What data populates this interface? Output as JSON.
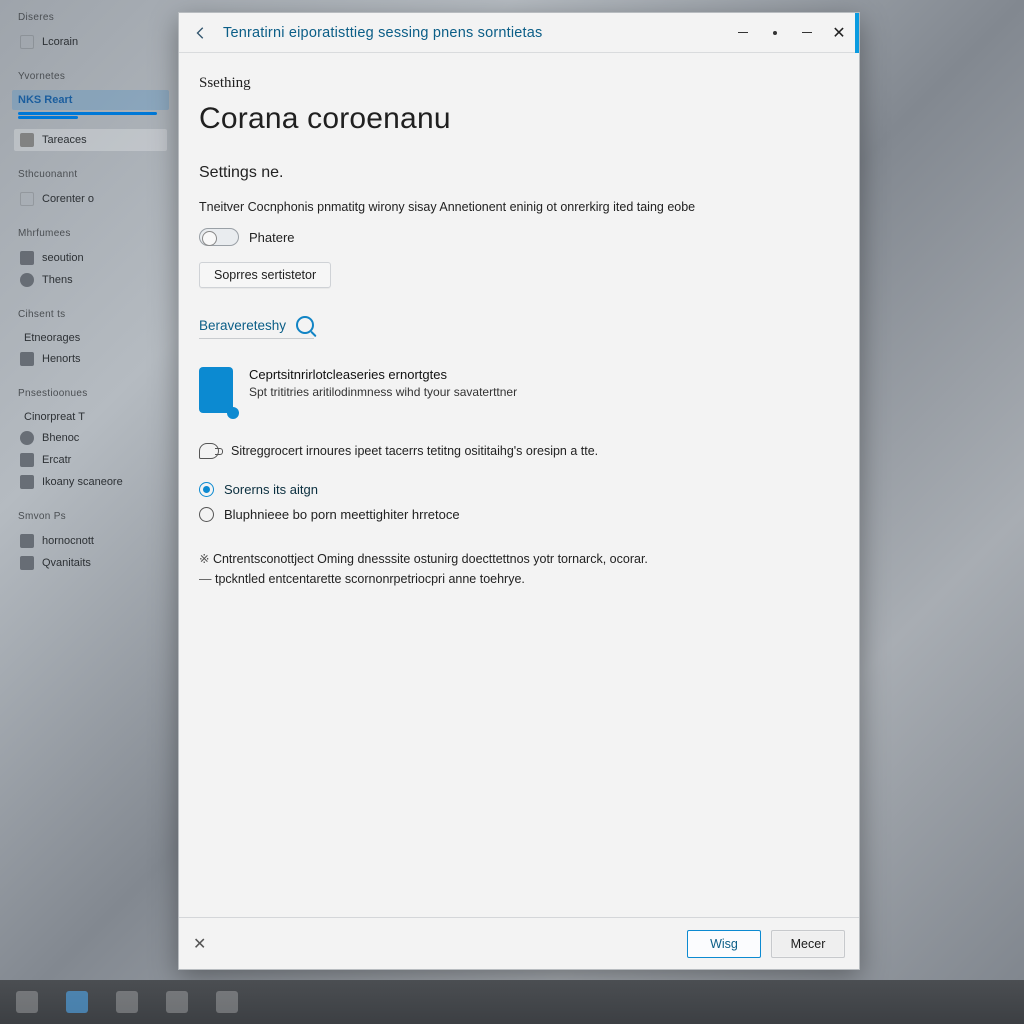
{
  "colors": {
    "accent": "#0078d7",
    "link": "#0b5e87"
  },
  "sidebar": {
    "sections": [
      {
        "header": "Diseres",
        "items": [
          {
            "label": "Lcorain"
          }
        ]
      },
      {
        "header": "Yvornetes",
        "items": [
          {
            "label": "NKS Reart",
            "accent": true
          },
          {
            "label": "Tareaces",
            "accent_box": true
          }
        ]
      },
      {
        "header": "Sthcuonannt",
        "items": [
          {
            "label": "Corenter o"
          }
        ]
      },
      {
        "header": "Mhrfumees",
        "items": [
          {
            "label": "seoution"
          },
          {
            "label": "Thens"
          }
        ]
      },
      {
        "header": "Cihsent ts",
        "items": [
          {
            "label": "Etneorages"
          },
          {
            "label": "Henorts"
          }
        ]
      },
      {
        "header": "Pnsestioonues",
        "items": [
          {
            "label": "Cinorpreat T"
          },
          {
            "label": "Bhenoc"
          },
          {
            "label": "Ercatr"
          },
          {
            "label": "Ikoany scaneore"
          }
        ]
      },
      {
        "header": "Smvon Ps",
        "items": [
          {
            "label": "hornocnott"
          },
          {
            "label": "Qvanitaits"
          }
        ]
      }
    ]
  },
  "window": {
    "titlebar": "Tenratirni eiporatisttieg sessing pnens sorntietas",
    "small_heading": "Ssething",
    "page_title": "Corana coroenanu",
    "section_label": "Settings ne.",
    "description": "Tneitver Cocnphonis pnmatitg wirony sisay Annetionent eninig ot onrerkirg ited taing eobe",
    "toggle": {
      "state": "off",
      "label": "Phatere"
    },
    "secondary_button": "Soprres sertistetor",
    "search_link": "Beravereteshy",
    "info_tile": {
      "title": "Ceprtsitnrirlotcleaseries ernortgtes",
      "subtitle": "Spt trititries aritilodinmness wihd tyour savaterttner"
    },
    "icon_line": "Sitreggrocert irnoures ipeet tacerrs tetitng osititaihg's oresipn a tte.",
    "radios": {
      "selected": 0,
      "options": [
        "Sorerns its aitgn",
        "Bluphnieee bo porn meettighiter hrretoce"
      ]
    },
    "note_lines": [
      "Cntrentsconottject Oming dnesssite ostunirg doecttettnos yotr tornarck, ocorar.",
      "tpckntled entcentarette scornonrpetriocpri anne toehrye."
    ],
    "buttons": {
      "cancel_x": "✕",
      "primary": "Wisg",
      "secondary": "Mecer"
    }
  },
  "taskbar": {
    "icons": [
      "start",
      "tray",
      "app1",
      "app2",
      "app3"
    ]
  }
}
